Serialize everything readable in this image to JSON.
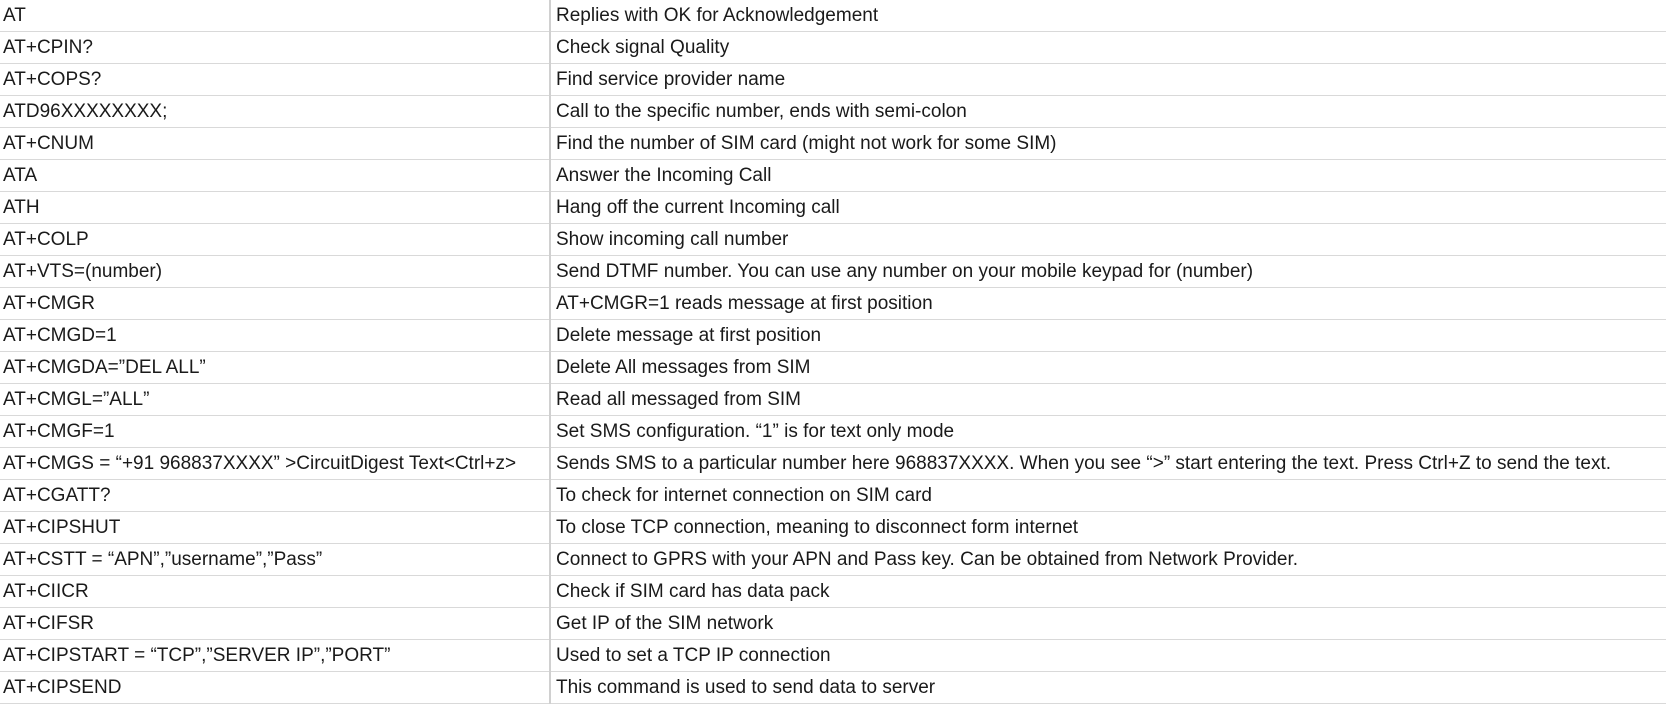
{
  "table": {
    "rows": [
      {
        "command": "AT",
        "description": "Replies with OK for Acknowledgement"
      },
      {
        "command": "AT+CPIN?",
        "description": "Check signal Quality"
      },
      {
        "command": "AT+COPS?",
        "description": "Find service provider name"
      },
      {
        "command": "ATD96XXXXXXXX;",
        "description": "Call to the specific number, ends with semi-colon"
      },
      {
        "command": "AT+CNUM",
        "description": "Find the number of SIM card (might not work for some SIM)"
      },
      {
        "command": "ATA",
        "description": "Answer the Incoming Call"
      },
      {
        "command": "ATH",
        "description": "Hang off the current Incoming call"
      },
      {
        "command": "AT+COLP",
        "description": "Show incoming call number"
      },
      {
        "command": "AT+VTS=(number)",
        "description": "Send DTMF number. You can use any number on your mobile keypad for (number)"
      },
      {
        "command": "AT+CMGR",
        "description": "AT+CMGR=1 reads message at first position"
      },
      {
        "command": "AT+CMGD=1",
        "description": "Delete message at first position"
      },
      {
        "command": "AT+CMGDA=”DEL ALL”",
        "description": "Delete All messages from SIM"
      },
      {
        "command": "AT+CMGL=”ALL”",
        "description": "Read all messaged from SIM"
      },
      {
        "command": "AT+CMGF=1",
        "description": "Set SMS configuration. “1” is for text only mode"
      },
      {
        "command": "AT+CMGS = “+91 968837XXXX” >CircuitDigest Text<Ctrl+z>",
        "description": "Sends SMS to a particular number here 968837XXXX. When you see “>” start entering the text. Press Ctrl+Z to send the text."
      },
      {
        "command": "AT+CGATT?",
        "description": "To check for internet connection on SIM card"
      },
      {
        "command": "AT+CIPSHUT",
        "description": "To close TCP connection, meaning to disconnect form internet"
      },
      {
        "command": "AT+CSTT = “APN”,”username”,”Pass”",
        "description": "Connect to GPRS with your APN and Pass key. Can be obtained from Network Provider."
      },
      {
        "command": "AT+CIICR",
        "description": "Check if SIM card has data pack"
      },
      {
        "command": "AT+CIFSR",
        "description": "Get IP of the SIM network"
      },
      {
        "command": "AT+CIPSTART = “TCP”,”SERVER IP”,”PORT”",
        "description": "Used to set a TCP IP connection"
      },
      {
        "command": "AT+CIPSEND",
        "description": "This command is used to send data to server"
      }
    ]
  },
  "colors": {
    "grid_line": "#d9d9d9",
    "text": "#1a1a1a",
    "background": "#ffffff"
  }
}
